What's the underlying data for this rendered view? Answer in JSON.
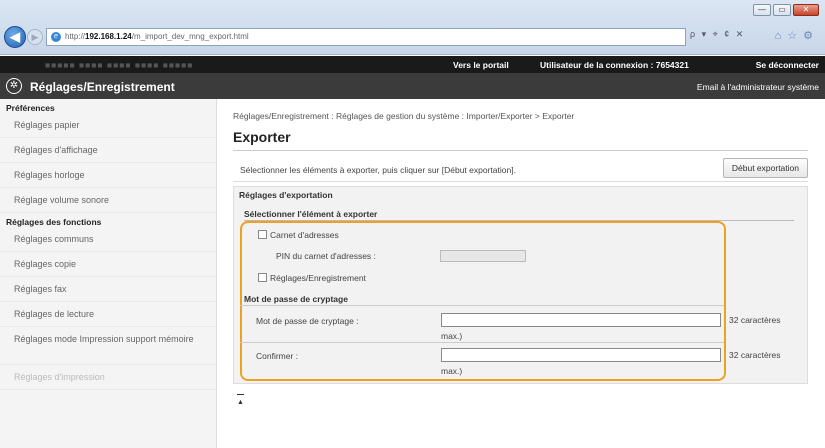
{
  "browser": {
    "url_prefix": "http://",
    "url_host": "192.168.1.24",
    "url_path": "/m_import_dev_mng_export.html",
    "search_tools": "ρ ▾ ⌖ ¢ ✕",
    "win_minimize": "—",
    "win_maximize": "▭",
    "win_close": "✕"
  },
  "topbar": {
    "device_name": "■■■■■ ■■■■ ■■■■ ■■■■ ■■■■■",
    "portal_link": "Vers le portail",
    "user_label": "Utilisateur de la connexion :",
    "user_id": "7654321",
    "logout_link": "Se déconnecter"
  },
  "header": {
    "title": "Réglages/Enregistrement",
    "email_admin": "Email à l'administrateur système"
  },
  "sidebar": {
    "sections": [
      {
        "heading": "Préférences",
        "items": [
          "Réglages papier",
          "Réglages d'affichage",
          "Réglages horloge",
          "Réglage volume sonore"
        ]
      },
      {
        "heading": "Réglages des fonctions",
        "items": [
          "Réglages communs",
          "Réglages copie",
          "Réglages fax",
          "Réglages de lecture",
          "Réglages mode Impression support mémoire",
          "Réglages d'impression"
        ]
      }
    ]
  },
  "main": {
    "breadcrumb": "Réglages/Enregistrement : Réglages de gestion du système : Importer/Exporter > Exporter",
    "title": "Exporter",
    "intro": "Sélectionner les éléments à exporter, puis cliquer sur [Début exportation].",
    "start_button": "Début exportation",
    "section_title": "Réglages d'exportation",
    "subsection_title": "Sélectionner l'élément à exporter",
    "address_book_label": "Carnet d'adresses",
    "address_book_checked": false,
    "pin_label": "PIN du carnet d'adresses :",
    "settings_label": "Réglages/Enregistrement",
    "settings_checked": false,
    "password_section": "Mot de passe de cryptage",
    "password_label": "Mot de passe de cryptage :",
    "password_hint_a": "32 caractères",
    "password_hint_b": "max.)",
    "confirm_label": "Confirmer :",
    "confirm_hint_a": "32 caractères",
    "confirm_hint_b": "max.)",
    "top_link": "▲"
  }
}
